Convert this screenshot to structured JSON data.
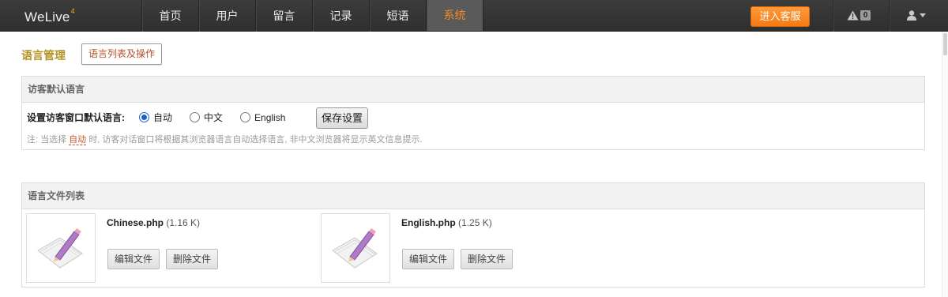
{
  "app": {
    "brand_name": "WeLive",
    "brand_version": "4"
  },
  "nav": {
    "items": [
      {
        "label": "首页",
        "active": false
      },
      {
        "label": "用户",
        "active": false
      },
      {
        "label": "留言",
        "active": false
      },
      {
        "label": "记录",
        "active": false
      },
      {
        "label": "短语",
        "active": false
      },
      {
        "label": "系统",
        "active": true
      }
    ],
    "enter_service_label": "进入客服",
    "alert_count": "0",
    "colors": {
      "accent": "#f08a24",
      "button": "#f47a12"
    }
  },
  "page": {
    "title": "语言管理",
    "tab_label": "语言列表及操作"
  },
  "default_lang_panel": {
    "heading": "访客默认语言",
    "setting_label": "设置访客窗口默认语言:",
    "options": [
      {
        "label": "自动",
        "checked": true
      },
      {
        "label": "中文",
        "checked": false
      },
      {
        "label": "English",
        "checked": false
      }
    ],
    "save_label": "保存设置",
    "note_prefix": "注: 当选择 ",
    "note_em": "自动",
    "note_suffix": " 时, 访客对话窗口将根据其浏览器语言自动选择语言, 非中文浏览器将显示英文信息提示."
  },
  "file_list_panel": {
    "heading": "语言文件列表",
    "files": [
      {
        "name": "Chinese.php",
        "size": "(1.16 K)",
        "edit_label": "编辑文件",
        "delete_label": "删除文件"
      },
      {
        "name": "English.php",
        "size": "(1.25 K)",
        "edit_label": "编辑文件",
        "delete_label": "删除文件"
      }
    ]
  }
}
